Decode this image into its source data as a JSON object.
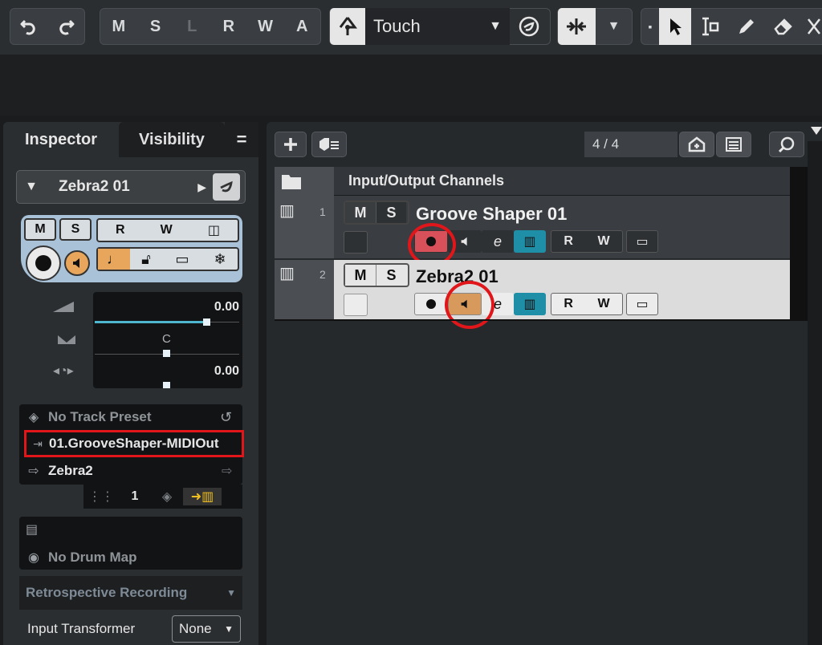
{
  "toolbar": {
    "automation_buttons": [
      "M",
      "S",
      "L",
      "R",
      "W",
      "A"
    ],
    "automation_mode": "Touch"
  },
  "inspector": {
    "tabs": {
      "inspector": "Inspector",
      "visibility": "Visibility"
    },
    "track_name": "Zebra2 01",
    "volume_value": "0.00",
    "pan_value": "C",
    "delay_value": "0.00",
    "track_preset": "No Track Preset",
    "input_routing": "01.GrooveShaper-MIDIOut",
    "output_routing": "Zebra2",
    "midi_channel": "1",
    "drum_map": "No Drum Map",
    "retrospective": "Retrospective Recording",
    "input_transformer_label": "Input Transformer",
    "input_transformer_value": "None",
    "buttons": {
      "m": "M",
      "s": "S",
      "r": "R",
      "w": "W"
    },
    "accent_color": "#e8a55c",
    "highlight_color": "#e0161a"
  },
  "project": {
    "counter": "4 / 4",
    "folder_label": "Input/Output Channels",
    "tracks": [
      {
        "num": "1",
        "name": "Groove Shaper 01",
        "m": "M",
        "s": "S",
        "r": "R",
        "w": "W",
        "record_active": true,
        "monitor_active": false
      },
      {
        "num": "2",
        "name": "Zebra2 01",
        "m": "M",
        "s": "S",
        "r": "R",
        "w": "W",
        "record_active": false,
        "monitor_active": true
      }
    ],
    "record_color": "#d8505a",
    "monitor_color": "#d89a5c",
    "midi_color": "#1f8fa8"
  }
}
